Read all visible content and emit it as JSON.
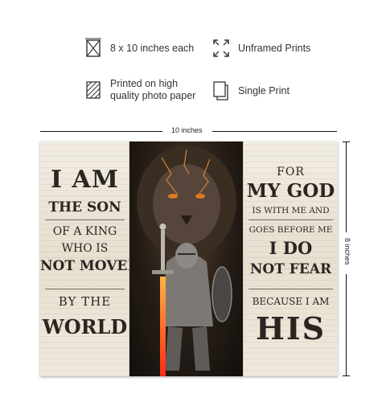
{
  "features": [
    {
      "icon": "ruler-square-icon",
      "text": "8 x 10 inches each"
    },
    {
      "icon": "corners-expand-icon",
      "text": "Unframed Prints"
    },
    {
      "icon": "hatched-paper-icon",
      "text_lines": [
        "Printed on high",
        "quality photo paper"
      ]
    },
    {
      "icon": "stacked-sheet-icon",
      "text": "Single Print"
    }
  ],
  "dimensions": {
    "width_label": "10 inches",
    "height_label": "8 inches"
  },
  "print": {
    "left_panel": {
      "lines": [
        "I AM",
        "THE SON",
        "OF A KING",
        "WHO IS",
        "NOT MOVED",
        "BY THE",
        "WORLD"
      ]
    },
    "center_panel": {
      "image": "lion-knight-artwork"
    },
    "right_panel": {
      "lines": [
        "FOR",
        "MY GOD",
        "IS WITH ME AND",
        "GOES BEFORE ME",
        "I DO",
        "NOT FEAR",
        "BECAUSE I AM",
        "HIS"
      ]
    }
  }
}
